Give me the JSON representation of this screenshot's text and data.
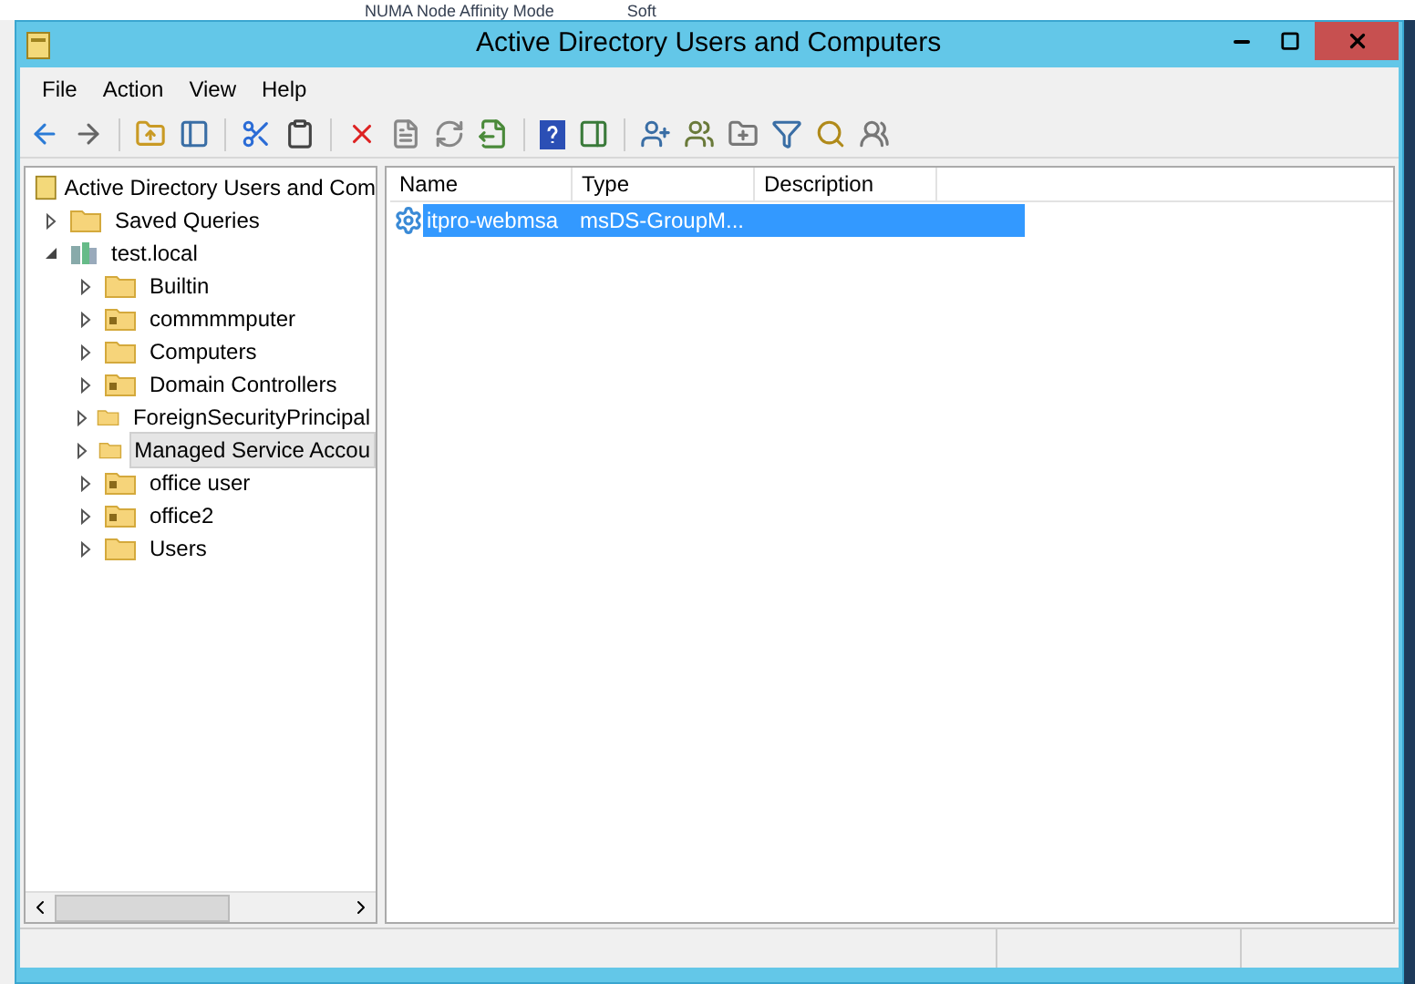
{
  "background": {
    "texts": [
      "NUMA Node Affinity Mode",
      "Soft"
    ]
  },
  "window": {
    "title": "Active Directory Users and Computers"
  },
  "menu": [
    "File",
    "Action",
    "View",
    "Help"
  ],
  "tree": {
    "root": "Active Directory Users and Com",
    "items": [
      {
        "label": "Saved Queries",
        "kind": "folder",
        "expanded": false,
        "selected": false
      },
      {
        "label": "test.local",
        "kind": "domain",
        "expanded": true,
        "selected": false,
        "children": [
          {
            "label": "Builtin",
            "kind": "folder",
            "expanded": false,
            "selected": false
          },
          {
            "label": "commmmputer",
            "kind": "ou",
            "expanded": false,
            "selected": false
          },
          {
            "label": "Computers",
            "kind": "folder",
            "expanded": false,
            "selected": false
          },
          {
            "label": "Domain Controllers",
            "kind": "ou",
            "expanded": false,
            "selected": false
          },
          {
            "label": "ForeignSecurityPrincipal",
            "kind": "folder",
            "expanded": false,
            "selected": false
          },
          {
            "label": "Managed Service Accou",
            "kind": "folder",
            "expanded": false,
            "selected": true
          },
          {
            "label": "office user",
            "kind": "ou",
            "expanded": false,
            "selected": false
          },
          {
            "label": "office2",
            "kind": "ou",
            "expanded": false,
            "selected": false
          },
          {
            "label": "Users",
            "kind": "folder",
            "expanded": false,
            "selected": false
          }
        ]
      }
    ]
  },
  "list": {
    "columns": [
      "Name",
      "Type",
      "Description"
    ],
    "rows": [
      {
        "name": "itpro-webmsa",
        "type": "msDS-GroupM...",
        "description": "",
        "selected": true
      }
    ]
  }
}
